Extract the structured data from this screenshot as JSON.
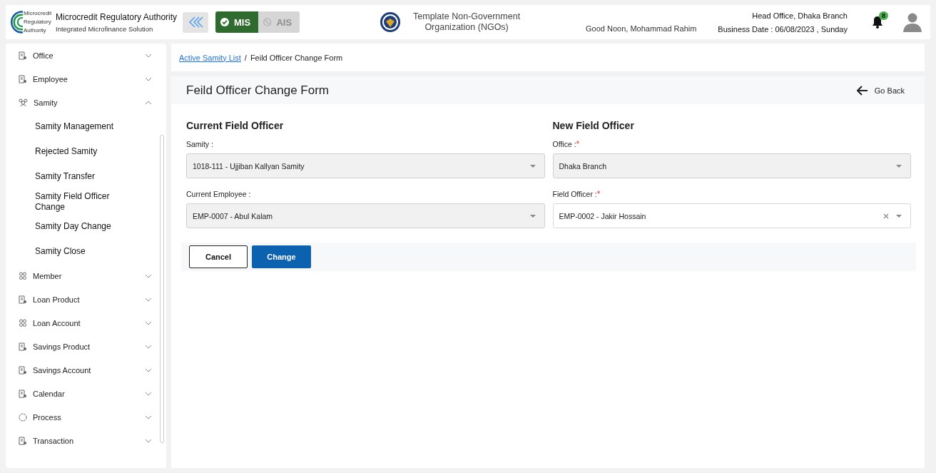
{
  "header": {
    "org_name": "Microcredit Regulatory Authority",
    "org_subtitle": "Integrated Microfinance Solution",
    "logo_text": [
      "Microcredit",
      "Regulatory",
      "Authority"
    ],
    "modules": [
      {
        "label": "MIS",
        "selected": true
      },
      {
        "label": "AIS",
        "selected": false
      }
    ],
    "ngo_name": "Template Non-Government Organization (NGOs)",
    "greeting": "Good Noon, Mohammad Rahim",
    "office": "Head Office, Dhaka Branch",
    "business_date": "Business Date : 06/08/2023 , Sunday",
    "notification_count": "8"
  },
  "sidebar": {
    "items": [
      {
        "label": "Office",
        "kind": "doc",
        "expanded": false
      },
      {
        "label": "Employee",
        "kind": "doc",
        "expanded": false
      },
      {
        "label": "Samity",
        "kind": "group",
        "expanded": true,
        "children": [
          {
            "label": "Samity Management"
          },
          {
            "label": "Rejected Samity"
          },
          {
            "label": "Samity Transfer"
          },
          {
            "label": "Samity Field Officer Change"
          },
          {
            "label": "Samity Day Change"
          },
          {
            "label": "Samity Close"
          }
        ]
      },
      {
        "label": "Member",
        "kind": "people",
        "expanded": false
      },
      {
        "label": "Loan Product",
        "kind": "doc",
        "expanded": false
      },
      {
        "label": "Loan Account",
        "kind": "people",
        "expanded": false
      },
      {
        "label": "Savings Product",
        "kind": "doc",
        "expanded": false
      },
      {
        "label": "Savings Account",
        "kind": "doc",
        "expanded": false
      },
      {
        "label": "Calendar",
        "kind": "doc",
        "expanded": false
      },
      {
        "label": "Process",
        "kind": "circle",
        "expanded": false
      },
      {
        "label": "Transaction",
        "kind": "doc",
        "expanded": false
      }
    ]
  },
  "breadcrumb": {
    "separator": "/",
    "items": [
      {
        "label": "Active Samity List",
        "kind": "link"
      },
      {
        "label": "Feild Officer Change Form",
        "kind": "current"
      }
    ]
  },
  "form": {
    "title": "Feild Officer Change Form",
    "go_back": "Go Back",
    "sections": [
      {
        "heading": "Current Field Officer",
        "fields": [
          {
            "label": "Samity :",
            "value": "1018-111 - Ujjiban Kallyan Samity",
            "disabled": true
          },
          {
            "label": "Current Employee :",
            "value": "EMP-0007 - Abul Kalam",
            "disabled": true
          }
        ]
      },
      {
        "heading": "New Field Officer",
        "fields": [
          {
            "label": "Office :",
            "required_mark": "*",
            "value": "Dhaka Branch",
            "disabled": true
          },
          {
            "label": "Field Officer :",
            "required_mark": "*",
            "value": "EMP-0002 - Jakir Hossain",
            "disabled": false,
            "clearable": true
          }
        ]
      }
    ],
    "buttons": [
      {
        "label": "Cancel",
        "kind": "outline"
      },
      {
        "label": "Change",
        "kind": "primary"
      }
    ]
  }
}
